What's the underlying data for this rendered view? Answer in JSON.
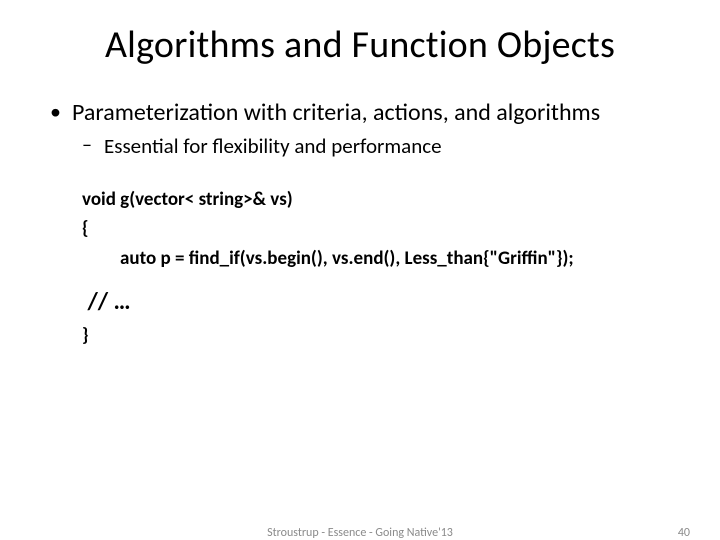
{
  "title": "Algorithms and Function Objects",
  "bullets": {
    "b1": "Parameterization with criteria, actions, and algorithms",
    "b2": "Essential  for flexibility and performance"
  },
  "code": {
    "l1": "void g(vector< string>& vs)",
    "l2": "{",
    "l3": "auto p = find_if(vs.begin(), vs.end(), Less_than{\"Griffin\"});",
    "l4": "// …",
    "l5": "}"
  },
  "footer": {
    "center": "Stroustrup - Essence - Going Native'13",
    "page": "40"
  }
}
